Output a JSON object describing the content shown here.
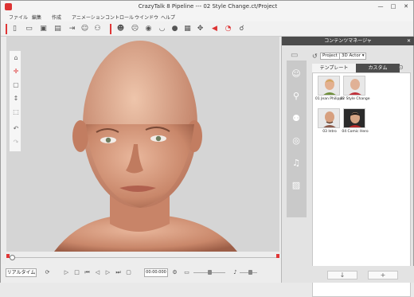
{
  "window": {
    "title": "CrazyTalk 8 Pipeline --- 02 Style Change.ct/Project",
    "minimize": "—",
    "maximize": "□",
    "close": "✕"
  },
  "menu": [
    "ファイル",
    "編集",
    "作成",
    "アニメーション",
    "コントロール",
    "ウインドウ",
    "ヘルプ"
  ],
  "toolbar_icons": [
    "new-file",
    "open-folder",
    "save",
    "scene",
    "import",
    "actor",
    "actor-wizard",
    "face-fitting",
    "face-profile",
    "eye",
    "mouth",
    "head",
    "texture",
    "checker",
    "puppet",
    "voice-record",
    "record-audio",
    "lip-sync"
  ],
  "left_tools": [
    "home-icon",
    "move-icon",
    "frame-icon",
    "fit-icon",
    "zoom-icon",
    "undo-icon",
    "redo-icon"
  ],
  "timeline": {
    "position": 0
  },
  "bottom_bar": {
    "realtime_label": "リアルタイム",
    "timecode": "00:00:000"
  },
  "panel": {
    "header": "コンテンツマネージャ",
    "close": "✕",
    "breadcrumb": [
      "Project",
      "3D Actor"
    ],
    "tabs": [
      {
        "label": "テンプレート",
        "active": false
      },
      {
        "label": "カスタム",
        "active": true
      }
    ],
    "items": [
      {
        "label": "01 Jean Philippe",
        "avatar": "blond-man-green-shirt"
      },
      {
        "label": "02 Style Change",
        "avatar": "bald-man-red-shirt"
      },
      {
        "label": "03 Intro",
        "avatar": "bald-man-suspenders"
      },
      {
        "label": "04 Comic Hero",
        "avatar": "dark-hair-red-jacket"
      }
    ],
    "side_tabs": [
      "head-tab",
      "body-tab",
      "accessory-tab",
      "motion-tab",
      "sound-tab",
      "image-tab"
    ]
  },
  "colors": {
    "accent_red": "#e03636",
    "panel_header": "#4c4c4c",
    "viewport_bg": "#d5d5d5"
  }
}
